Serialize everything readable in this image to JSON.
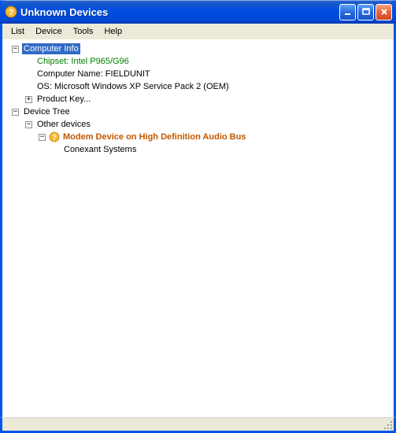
{
  "window": {
    "title": "Unknown Devices"
  },
  "menu": {
    "list": "List",
    "device": "Device",
    "tools": "Tools",
    "help": "Help"
  },
  "tree": {
    "computer_info": {
      "label": "Computer Info",
      "chipset": "Chipset: Intel P965/G96",
      "computer_name": "Computer Name: FIELDUNIT",
      "os": "OS: Microsoft Windows XP Service Pack 2 (OEM)",
      "product_key": "Product Key..."
    },
    "device_tree": {
      "label": "Device Tree",
      "other_devices": {
        "label": "Other devices",
        "modem": {
          "label": "Modem Device on High Definition Audio Bus",
          "vendor": "Conexant Systems"
        }
      }
    }
  }
}
